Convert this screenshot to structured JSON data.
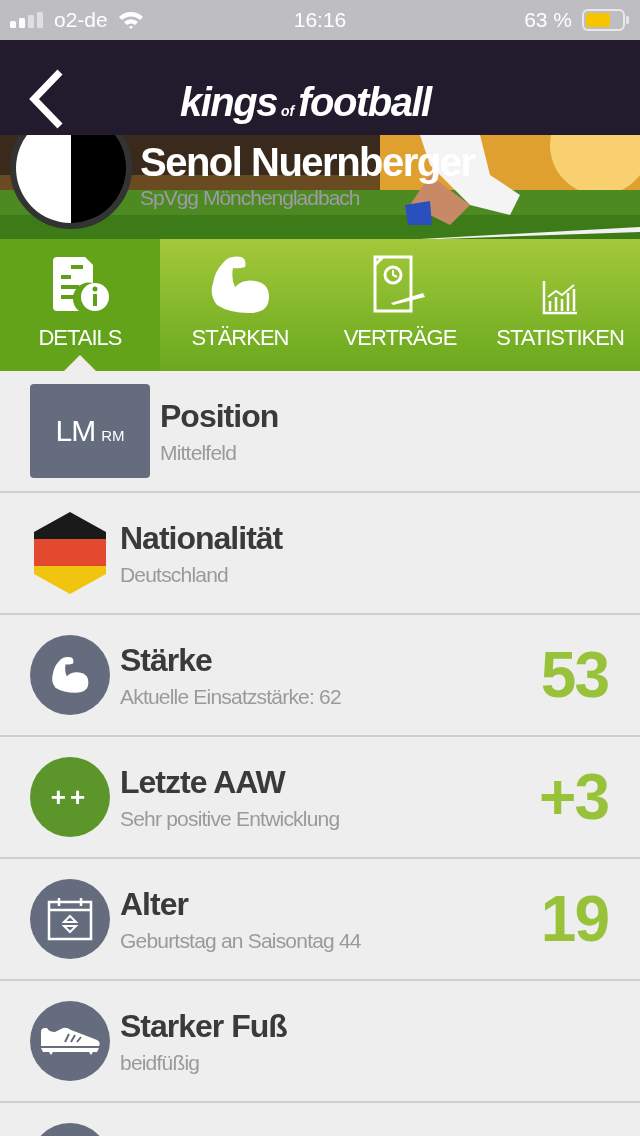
{
  "status_bar": {
    "carrier": "o2-de",
    "time": "16:16",
    "battery": "63 %"
  },
  "nav": {
    "logo_main": "kings",
    "logo_small": "of",
    "logo_end": "football"
  },
  "player": {
    "name": "Senol Nuernberger",
    "club": "SpVgg Mönchengladbach"
  },
  "tabs": [
    {
      "label": "DETAILS",
      "selected": true,
      "kind": "details"
    },
    {
      "label": "STÄRKEN",
      "selected": false,
      "kind": "strength"
    },
    {
      "label": "VERTRÄGE",
      "selected": false,
      "kind": "contract"
    },
    {
      "label": "STATISTIKEN",
      "selected": false,
      "kind": "stats"
    }
  ],
  "rows": [
    {
      "kind": "position",
      "badge_main": "LM",
      "badge_sub": "RM",
      "title": "Position",
      "subtitle": "Mittelfeld"
    },
    {
      "kind": "flag",
      "title": "Nationalität",
      "subtitle": "Deutschland"
    },
    {
      "kind": "strength",
      "title": "Stärke",
      "subtitle": "Aktuelle Einsatzstärke: 62",
      "value": "53",
      "color": "#646c7e"
    },
    {
      "kind": "development",
      "badge_main": "++",
      "title": "Letzte AAW",
      "subtitle": "Sehr positive Entwicklung",
      "value": "+3",
      "color": "#5c962a"
    },
    {
      "kind": "age",
      "title": "Alter",
      "subtitle": "Geburtstag an Saisontag 44",
      "value": "19",
      "color": "#646c7e"
    },
    {
      "kind": "foot",
      "title": "Starker Fuß",
      "subtitle": "beidfüßig",
      "color": "#646c7e"
    }
  ]
}
